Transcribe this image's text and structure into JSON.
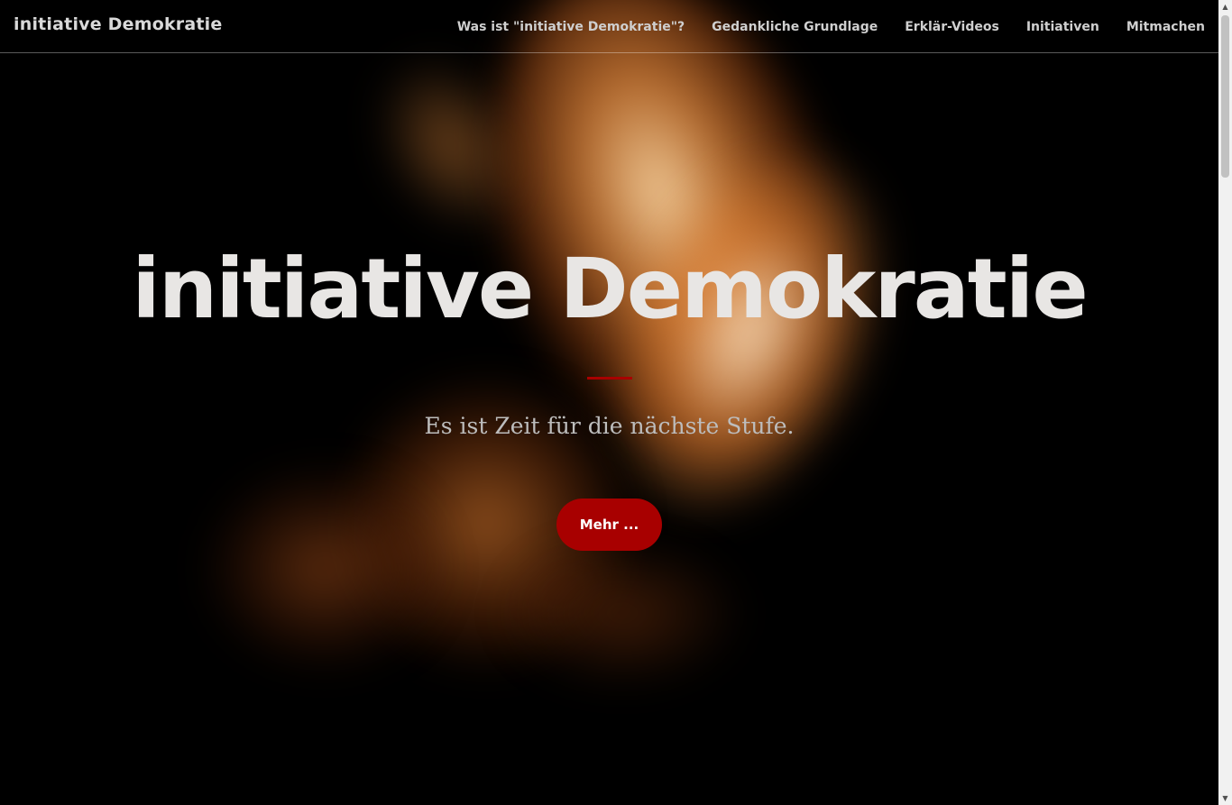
{
  "navbar": {
    "brand": "initiative Demokratie",
    "links": [
      {
        "label": "Was ist \"initiative Demokratie\"?"
      },
      {
        "label": "Gedankliche Grundlage"
      },
      {
        "label": "Erklär-Videos"
      },
      {
        "label": "Initiativen"
      },
      {
        "label": "Mitmachen"
      }
    ]
  },
  "hero": {
    "title": "initiative Demokratie",
    "subtitle": "Es ist Zeit für die nächste Stufe.",
    "button_label": "Mehr ..."
  },
  "colors": {
    "accent": "#a80000",
    "background": "#000000",
    "title_text": "#e8e6e4",
    "subtitle_text": "#bdbdbd"
  },
  "scrollbar": {
    "up_icon": "chevron-up-icon",
    "down_icon": "chevron-down-icon"
  }
}
